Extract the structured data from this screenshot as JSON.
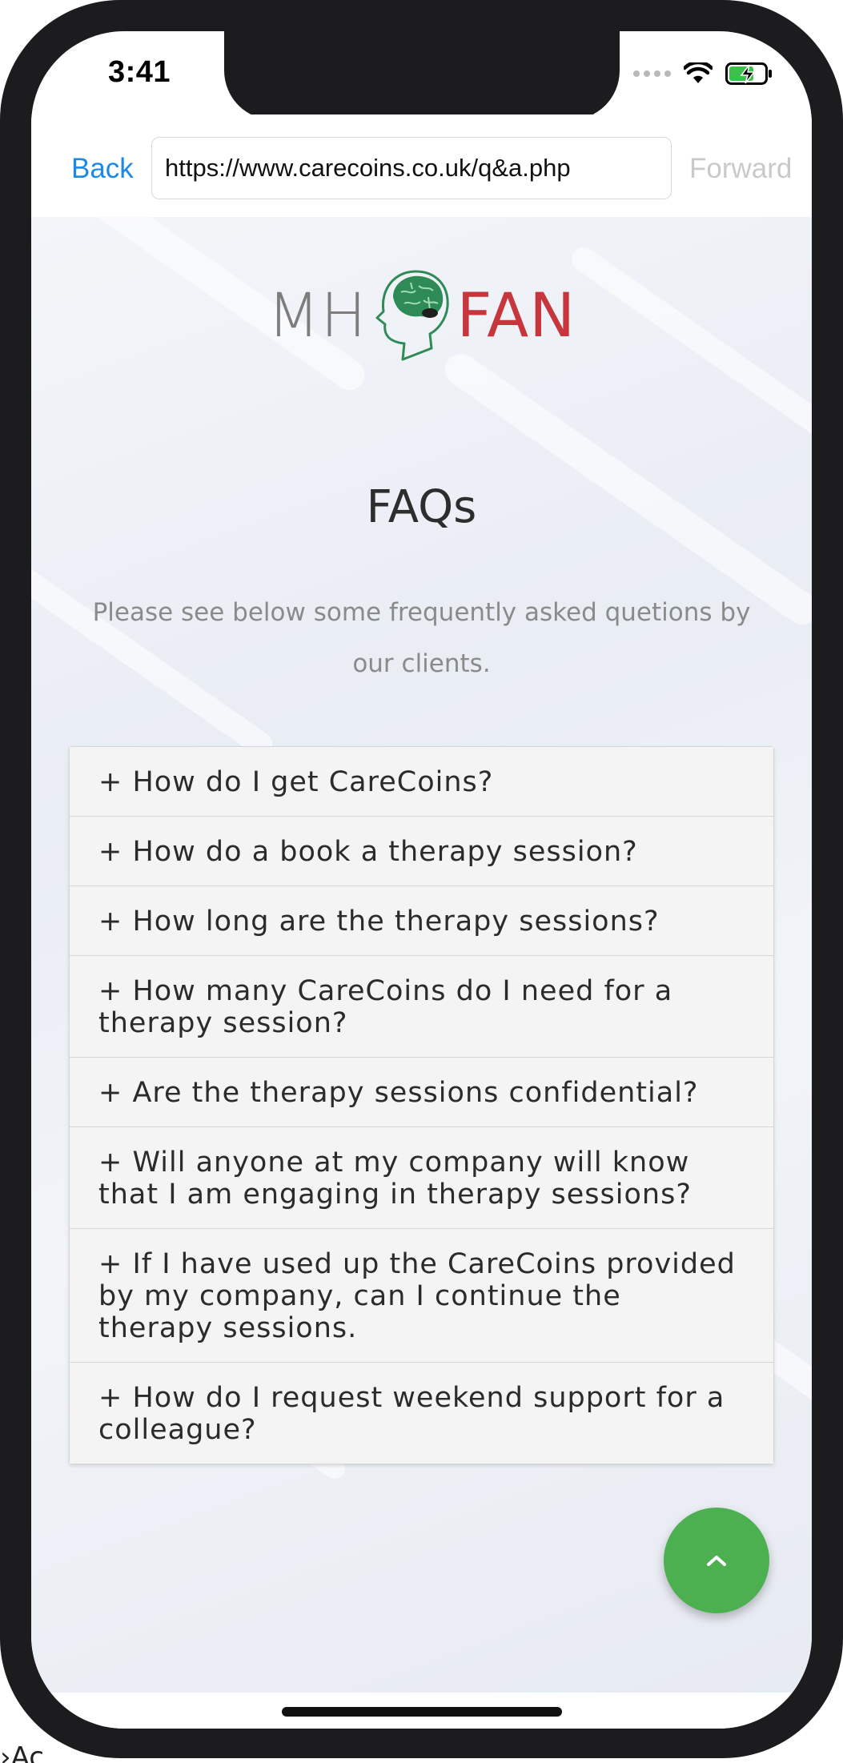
{
  "status_bar": {
    "time": "3:41"
  },
  "browser": {
    "back_label": "Back",
    "url": "https://www.carecoins.co.uk/q&a.php",
    "forward_label": "Forward"
  },
  "logo": {
    "left_text": "MH",
    "right_text": "FAN"
  },
  "page": {
    "title": "FAQs",
    "intro": "Please see below some frequently asked quetions by our clients."
  },
  "faqs": [
    "+ How do I get CareCoins?",
    "+ How do a book a therapy session?",
    "+ How long are the therapy sessions?",
    "+ How many CareCoins do I need for a therapy session?",
    "+ Are the therapy sessions confidential?",
    "+ Will anyone at my company will know that I am engaging in therapy sessions?",
    "+ If I have used up the CareCoins provided by my company, can I continue the therapy sessions.",
    "+ How do I request weekend support for a colleague?"
  ],
  "stray_text": "›Ac",
  "colors": {
    "accent_blue": "#1e88e5",
    "brand_red": "#c6363c",
    "brand_grey": "#7d7d7d",
    "brain_green": "#2e8b57",
    "scroll_button_green": "#4caf50"
  },
  "icons": {
    "wifi": "wifi-icon",
    "battery": "battery-charging-icon",
    "scroll_top": "chevron-up-icon",
    "logo_head": "brain-head-icon"
  }
}
